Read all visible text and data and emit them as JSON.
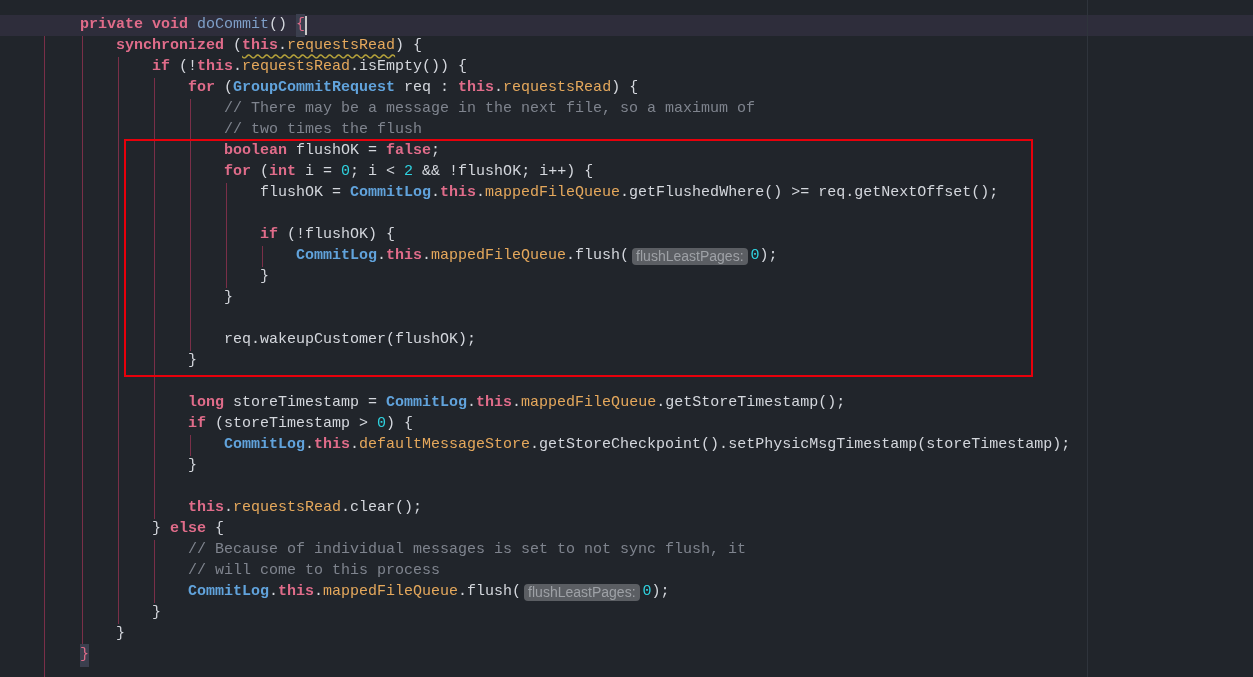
{
  "code": [
    {
      "tokens": [
        {
          "kind": "kw",
          "text": "private void "
        },
        {
          "kind": "fn",
          "text": "doCommit"
        },
        {
          "kind": "plain",
          "text": "() "
        },
        {
          "kind": "match",
          "text": "{"
        },
        {
          "kind": "caret"
        }
      ],
      "children": [
        {
          "tokens": [
            {
              "kind": "kw",
              "text": "synchronized"
            },
            {
              "kind": "plain",
              "text": " ("
            },
            {
              "kind": "warn",
              "tokens": [
                {
                  "kind": "kw",
                  "text": "this"
                },
                {
                  "kind": "plain",
                  "text": "."
                },
                {
                  "kind": "field",
                  "text": "requestsRead"
                }
              ]
            },
            {
              "kind": "plain",
              "text": ") {"
            }
          ],
          "children": [
            {
              "tokens": [
                {
                  "kind": "kw",
                  "text": "if"
                },
                {
                  "kind": "plain",
                  "text": " (!"
                },
                {
                  "kind": "kw",
                  "text": "this"
                },
                {
                  "kind": "plain",
                  "text": "."
                },
                {
                  "kind": "field",
                  "text": "requestsRead"
                },
                {
                  "kind": "plain",
                  "text": ".isEmpty()) {"
                }
              ],
              "children": [
                {
                  "tokens": [
                    {
                      "kind": "kw",
                      "text": "for"
                    },
                    {
                      "kind": "plain",
                      "text": " ("
                    },
                    {
                      "kind": "type",
                      "text": "GroupCommitRequest"
                    },
                    {
                      "kind": "plain",
                      "text": " req : "
                    },
                    {
                      "kind": "kw",
                      "text": "this"
                    },
                    {
                      "kind": "plain",
                      "text": "."
                    },
                    {
                      "kind": "field",
                      "text": "requestsRead"
                    },
                    {
                      "kind": "plain",
                      "text": ") {"
                    }
                  ],
                  "children": [
                    {
                      "tokens": [
                        {
                          "kind": "comment",
                          "text": "// There may be a message in the next file, so a maximum of"
                        }
                      ]
                    },
                    {
                      "tokens": [
                        {
                          "kind": "comment",
                          "text": "// two times the flush"
                        }
                      ]
                    },
                    {
                      "tokens": [
                        {
                          "kind": "kw",
                          "text": "boolean"
                        },
                        {
                          "kind": "plain",
                          "text": " flushOK = "
                        },
                        {
                          "kind": "kw",
                          "text": "false"
                        },
                        {
                          "kind": "plain",
                          "text": ";"
                        }
                      ]
                    },
                    {
                      "tokens": [
                        {
                          "kind": "kw",
                          "text": "for"
                        },
                        {
                          "kind": "plain",
                          "text": " ("
                        },
                        {
                          "kind": "kw",
                          "text": "int"
                        },
                        {
                          "kind": "plain",
                          "text": " i = "
                        },
                        {
                          "kind": "num",
                          "text": "0"
                        },
                        {
                          "kind": "plain",
                          "text": "; i < "
                        },
                        {
                          "kind": "num",
                          "text": "2"
                        },
                        {
                          "kind": "plain",
                          "text": " && !flushOK; i++) {"
                        }
                      ],
                      "children": [
                        {
                          "tokens": [
                            {
                              "kind": "plain",
                              "text": "flushOK = "
                            },
                            {
                              "kind": "type",
                              "text": "CommitLog"
                            },
                            {
                              "kind": "plain",
                              "text": "."
                            },
                            {
                              "kind": "kw",
                              "text": "this"
                            },
                            {
                              "kind": "plain",
                              "text": "."
                            },
                            {
                              "kind": "field",
                              "text": "mappedFileQueue"
                            },
                            {
                              "kind": "plain",
                              "text": ".getFlushedWhere() >= req.getNextOffset();"
                            }
                          ]
                        },
                        {
                          "kind": "blank"
                        },
                        {
                          "tokens": [
                            {
                              "kind": "kw",
                              "text": "if"
                            },
                            {
                              "kind": "plain",
                              "text": " (!flushOK) {"
                            }
                          ],
                          "children": [
                            {
                              "tokens": [
                                {
                                  "kind": "type",
                                  "text": "CommitLog"
                                },
                                {
                                  "kind": "plain",
                                  "text": "."
                                },
                                {
                                  "kind": "kw",
                                  "text": "this"
                                },
                                {
                                  "kind": "plain",
                                  "text": "."
                                },
                                {
                                  "kind": "field",
                                  "text": "mappedFileQueue"
                                },
                                {
                                  "kind": "plain",
                                  "text": ".flush("
                                },
                                {
                                  "kind": "hint",
                                  "text": "flushLeastPages:"
                                },
                                {
                                  "kind": "num",
                                  "text": "0"
                                },
                                {
                                  "kind": "plain",
                                  "text": ");"
                                }
                              ]
                            }
                          ]
                        },
                        {
                          "tokens": [
                            {
                              "kind": "plain",
                              "text": "}"
                            }
                          ]
                        }
                      ]
                    },
                    {
                      "tokens": [
                        {
                          "kind": "plain",
                          "text": "}"
                        }
                      ]
                    },
                    {
                      "kind": "blank"
                    },
                    {
                      "tokens": [
                        {
                          "kind": "plain",
                          "text": "req.wakeupCustomer(flushOK);"
                        }
                      ]
                    }
                  ]
                },
                {
                  "tokens": [
                    {
                      "kind": "plain",
                      "text": "}"
                    }
                  ]
                },
                {
                  "kind": "blank"
                },
                {
                  "tokens": [
                    {
                      "kind": "kw",
                      "text": "long"
                    },
                    {
                      "kind": "plain",
                      "text": " storeTimestamp = "
                    },
                    {
                      "kind": "type",
                      "text": "CommitLog"
                    },
                    {
                      "kind": "plain",
                      "text": "."
                    },
                    {
                      "kind": "kw",
                      "text": "this"
                    },
                    {
                      "kind": "plain",
                      "text": "."
                    },
                    {
                      "kind": "field",
                      "text": "mappedFileQueue"
                    },
                    {
                      "kind": "plain",
                      "text": ".getStoreTimestamp();"
                    }
                  ]
                },
                {
                  "tokens": [
                    {
                      "kind": "kw",
                      "text": "if"
                    },
                    {
                      "kind": "plain",
                      "text": " (storeTimestamp > "
                    },
                    {
                      "kind": "num",
                      "text": "0"
                    },
                    {
                      "kind": "plain",
                      "text": ") {"
                    }
                  ],
                  "children": [
                    {
                      "tokens": [
                        {
                          "kind": "type",
                          "text": "CommitLog"
                        },
                        {
                          "kind": "plain",
                          "text": "."
                        },
                        {
                          "kind": "kw",
                          "text": "this"
                        },
                        {
                          "kind": "plain",
                          "text": "."
                        },
                        {
                          "kind": "field",
                          "text": "defaultMessageStore"
                        },
                        {
                          "kind": "plain",
                          "text": ".getStoreCheckpoint().setPhysicMsgTimestamp(storeTimestamp);"
                        }
                      ]
                    }
                  ]
                },
                {
                  "tokens": [
                    {
                      "kind": "plain",
                      "text": "}"
                    }
                  ]
                },
                {
                  "kind": "blank"
                },
                {
                  "tokens": [
                    {
                      "kind": "kw",
                      "text": "this"
                    },
                    {
                      "kind": "plain",
                      "text": "."
                    },
                    {
                      "kind": "field",
                      "text": "requestsRead"
                    },
                    {
                      "kind": "plain",
                      "text": ".clear();"
                    }
                  ]
                }
              ]
            },
            {
              "tokens": [
                {
                  "kind": "plain",
                  "text": "} "
                },
                {
                  "kind": "kw",
                  "text": "else"
                },
                {
                  "kind": "plain",
                  "text": " {"
                }
              ],
              "children": [
                {
                  "tokens": [
                    {
                      "kind": "comment",
                      "text": "// Because of individual messages is set to not sync flush, it"
                    }
                  ]
                },
                {
                  "tokens": [
                    {
                      "kind": "comment",
                      "text": "// will come to this process"
                    }
                  ]
                },
                {
                  "tokens": [
                    {
                      "kind": "type",
                      "text": "CommitLog"
                    },
                    {
                      "kind": "plain",
                      "text": "."
                    },
                    {
                      "kind": "kw",
                      "text": "this"
                    },
                    {
                      "kind": "plain",
                      "text": "."
                    },
                    {
                      "kind": "field",
                      "text": "mappedFileQueue"
                    },
                    {
                      "kind": "plain",
                      "text": ".flush("
                    },
                    {
                      "kind": "hint",
                      "text": "flushLeastPages:"
                    },
                    {
                      "kind": "num",
                      "text": "0"
                    },
                    {
                      "kind": "plain",
                      "text": ");"
                    }
                  ]
                }
              ]
            },
            {
              "tokens": [
                {
                  "kind": "plain",
                  "text": "}"
                }
              ]
            }
          ]
        },
        {
          "tokens": [
            {
              "kind": "plain",
              "text": "}"
            }
          ]
        }
      ]
    },
    {
      "tokens": [
        {
          "kind": "match",
          "text": "}"
        }
      ]
    }
  ]
}
